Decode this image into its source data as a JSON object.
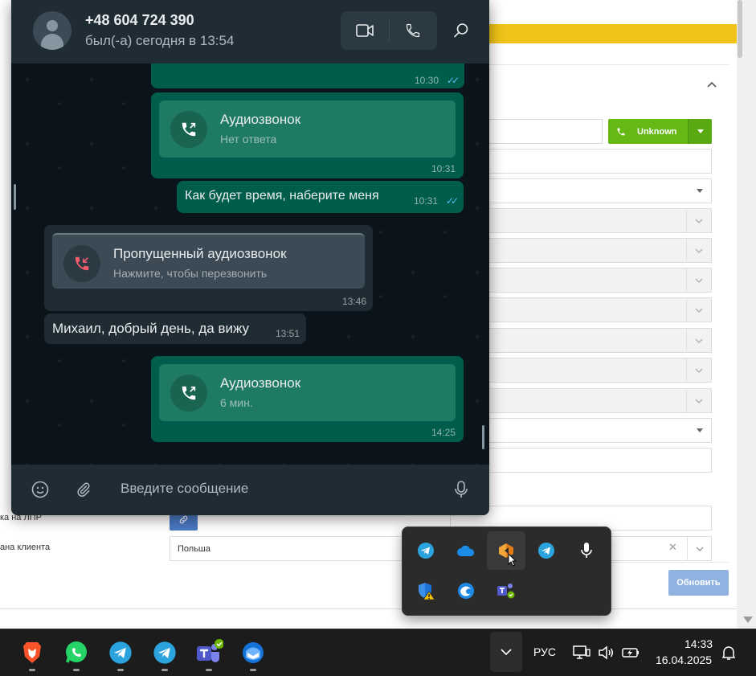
{
  "crm": {
    "call_button_label": "Unknown",
    "left_labels": [
      "ка на ЛПР",
      "ана клиента"
    ],
    "country_value": "Польша",
    "update_button": "Обновить"
  },
  "whatsapp": {
    "contact_name": "+48 604 724 390",
    "contact_status": "был(-а) сегодня в 13:54",
    "messages": [
      {
        "direction": "out",
        "time": "10:30",
        "ticks": "✓✓"
      },
      {
        "direction": "out",
        "kind": "call",
        "title": "Аудиозвонок",
        "subtitle": "Нет ответа",
        "time": "10:31"
      },
      {
        "direction": "out",
        "kind": "text",
        "text": "Как будет время, наберите меня",
        "time": "10:31",
        "ticks": "✓✓"
      },
      {
        "direction": "in",
        "kind": "call",
        "title": "Пропущенный аудиозвонок",
        "subtitle": "Нажмите, чтобы перезвонить",
        "time": "13:46"
      },
      {
        "direction": "in",
        "kind": "text",
        "text": "Михаил, добрый день, да вижу",
        "time": "13:51"
      },
      {
        "direction": "out",
        "kind": "call",
        "title": "Аудиозвонок",
        "subtitle": "6 мин.",
        "time": "14:25"
      }
    ],
    "composer_placeholder": "Введите сообщение"
  },
  "tray_icons": [
    "telegram-icon",
    "onedrive-icon",
    "gamebar-icon",
    "telegram-icon",
    "microphone-icon",
    "windows-security-warning-icon",
    "edge-update-icon",
    "teams-icon"
  ],
  "taskbar": {
    "apps": [
      "brave-icon",
      "whatsapp-icon",
      "telegram-icon",
      "telegram-icon",
      "teams-icon",
      "thunderbird-icon"
    ],
    "language": "РУС",
    "time": "14:33",
    "date": "16.04.2025"
  },
  "colors": {
    "wa_outgoing": "#005c4b",
    "wa_incoming": "#202c33",
    "crm_call_green": "#66b814",
    "crm_yellow": "#f0c419",
    "missed_call_red": "#f15c6d"
  }
}
